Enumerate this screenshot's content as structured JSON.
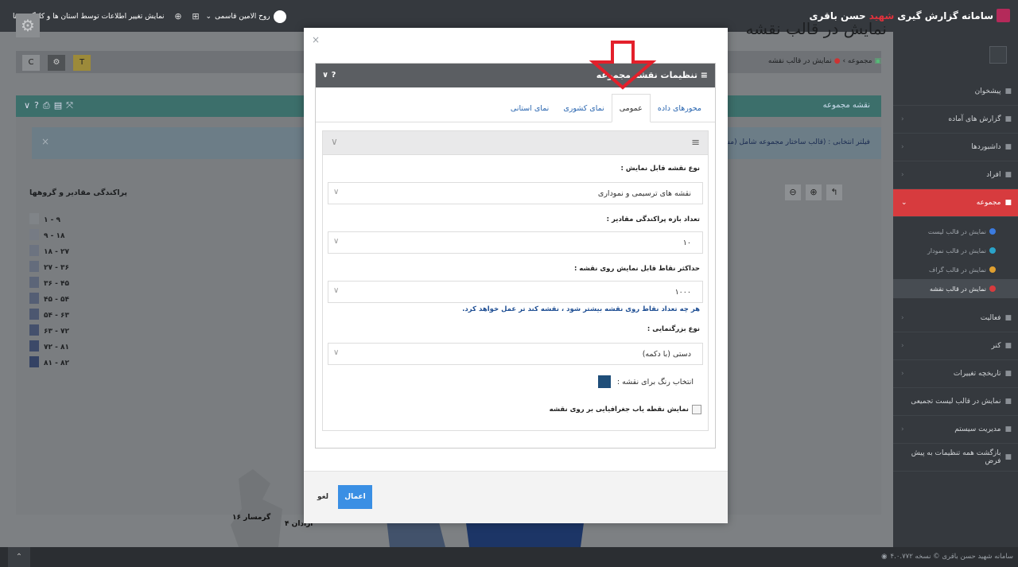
{
  "topbar": {
    "brand_prefix": "سامانه گزارش گیری",
    "brand_red": "شهید",
    "brand_suffix": "حسن باقری",
    "user_name": "روح الامین قاسمی",
    "status_text": "نمایش تغییر اطلاعات توسط استان ها و کارگروه ها"
  },
  "sidebar": {
    "items": [
      {
        "label": "پیشخوان",
        "has_chevron": false
      },
      {
        "label": "گزارش های آماده",
        "has_chevron": true
      },
      {
        "label": "داشبوردها",
        "has_chevron": true
      },
      {
        "label": "افراد",
        "has_chevron": true
      },
      {
        "label": "مجموعه",
        "has_chevron": true
      },
      {
        "label": "فعالیت",
        "has_chevron": true
      },
      {
        "label": "کنر",
        "has_chevron": true
      },
      {
        "label": "تاریخچه تغییرات",
        "has_chevron": true
      },
      {
        "label": "نمایش در قالب لیست تجمیعی",
        "has_chevron": false
      },
      {
        "label": "مدیریت سیستم",
        "has_chevron": true
      },
      {
        "label": "بازگشت همه تنظیمات به پیش فرض",
        "has_chevron": false
      }
    ],
    "subitems": [
      {
        "label": "نمایش در قالب لیست"
      },
      {
        "label": "نمایش در قالب نمودار"
      },
      {
        "label": "نمایش در قالب گراف"
      },
      {
        "label": "نمایش در قالب نقشه"
      }
    ]
  },
  "content": {
    "page_title": "نمایش در قالب نقشه",
    "breadcrumb_root": "مجموعه",
    "breadcrumb_current": "نمایش در قالب نقشه",
    "panel_title": "نقشه مجموعه",
    "filter_text": "فیلتر انتخابی : (قالب ساختار مجموعه شامل (مس",
    "legend_title": "پراکندگی مقادیر و گروهها",
    "legend_rows": [
      {
        "range": "۱ - ۹",
        "color": "#808488"
      },
      {
        "range": "۹ - ۱۸",
        "color": "#767b84"
      },
      {
        "range": "۱۸ - ۲۷",
        "color": "#6c7380"
      },
      {
        "range": "۲۷ - ۳۶",
        "color": "#646c7c"
      },
      {
        "range": "۳۶ - ۴۵",
        "color": "#5c6578"
      },
      {
        "range": "۴۵ - ۵۴",
        "color": "#545e74"
      },
      {
        "range": "۵۴ - ۶۳",
        "color": "#4c5770"
      },
      {
        "range": "۶۳ - ۷۲",
        "color": "#44506c"
      },
      {
        "range": "۷۲ - ۸۱",
        "color": "#3c4968"
      },
      {
        "range": "۸۱ - ۸۲",
        "color": "#344264"
      }
    ],
    "map_label_1": "گرمسار ۱۶",
    "map_label_2": "آرادان ۴"
  },
  "modal": {
    "panel_title": "تنظیمات نقشه مجموعه",
    "tabs": [
      {
        "label": "محورهای داده",
        "active": false
      },
      {
        "label": "عمومی",
        "active": true
      },
      {
        "label": "نمای کشوری",
        "active": false
      },
      {
        "label": "نمای استانی",
        "active": false
      }
    ],
    "fields": {
      "map_type_label": "نوع نقشه قابل نمایش :",
      "map_type_value": "نقشه های ترسیمی و نموداری",
      "ranges_label": "تعداد بازه پراکندگی مقادیر :",
      "ranges_value": "۱۰",
      "maxpoints_label": "حداکثر نقاط قابل نمایش روی نقشه :",
      "maxpoints_value": "۱۰۰۰",
      "maxpoints_hint": "هر چه تعداد نقاط روی نقشه بیشتر شود ، نقشه کند تر عمل خواهد کرد.",
      "zoom_label": "نوع بزرگنمایی :",
      "zoom_value": "دستی (با دکمه)",
      "color_label": "انتخاب رنگ برای نقشه :",
      "color_value": "#1f4e79",
      "geo_checkbox_label": "نمایش نقطه یاب جغرافیایی بر روی نقشه",
      "geo_checkbox_checked": false
    },
    "apply_label": "اعمال",
    "cancel_label": "لغو"
  },
  "footer": {
    "text": "سامانه شهید حسن باقری © نسخه ۴.۰.۷۷۲"
  },
  "colors": {
    "accent_red": "#d73b3e",
    "apply_blue": "#3a8fe4",
    "topbar": "#35393e"
  }
}
